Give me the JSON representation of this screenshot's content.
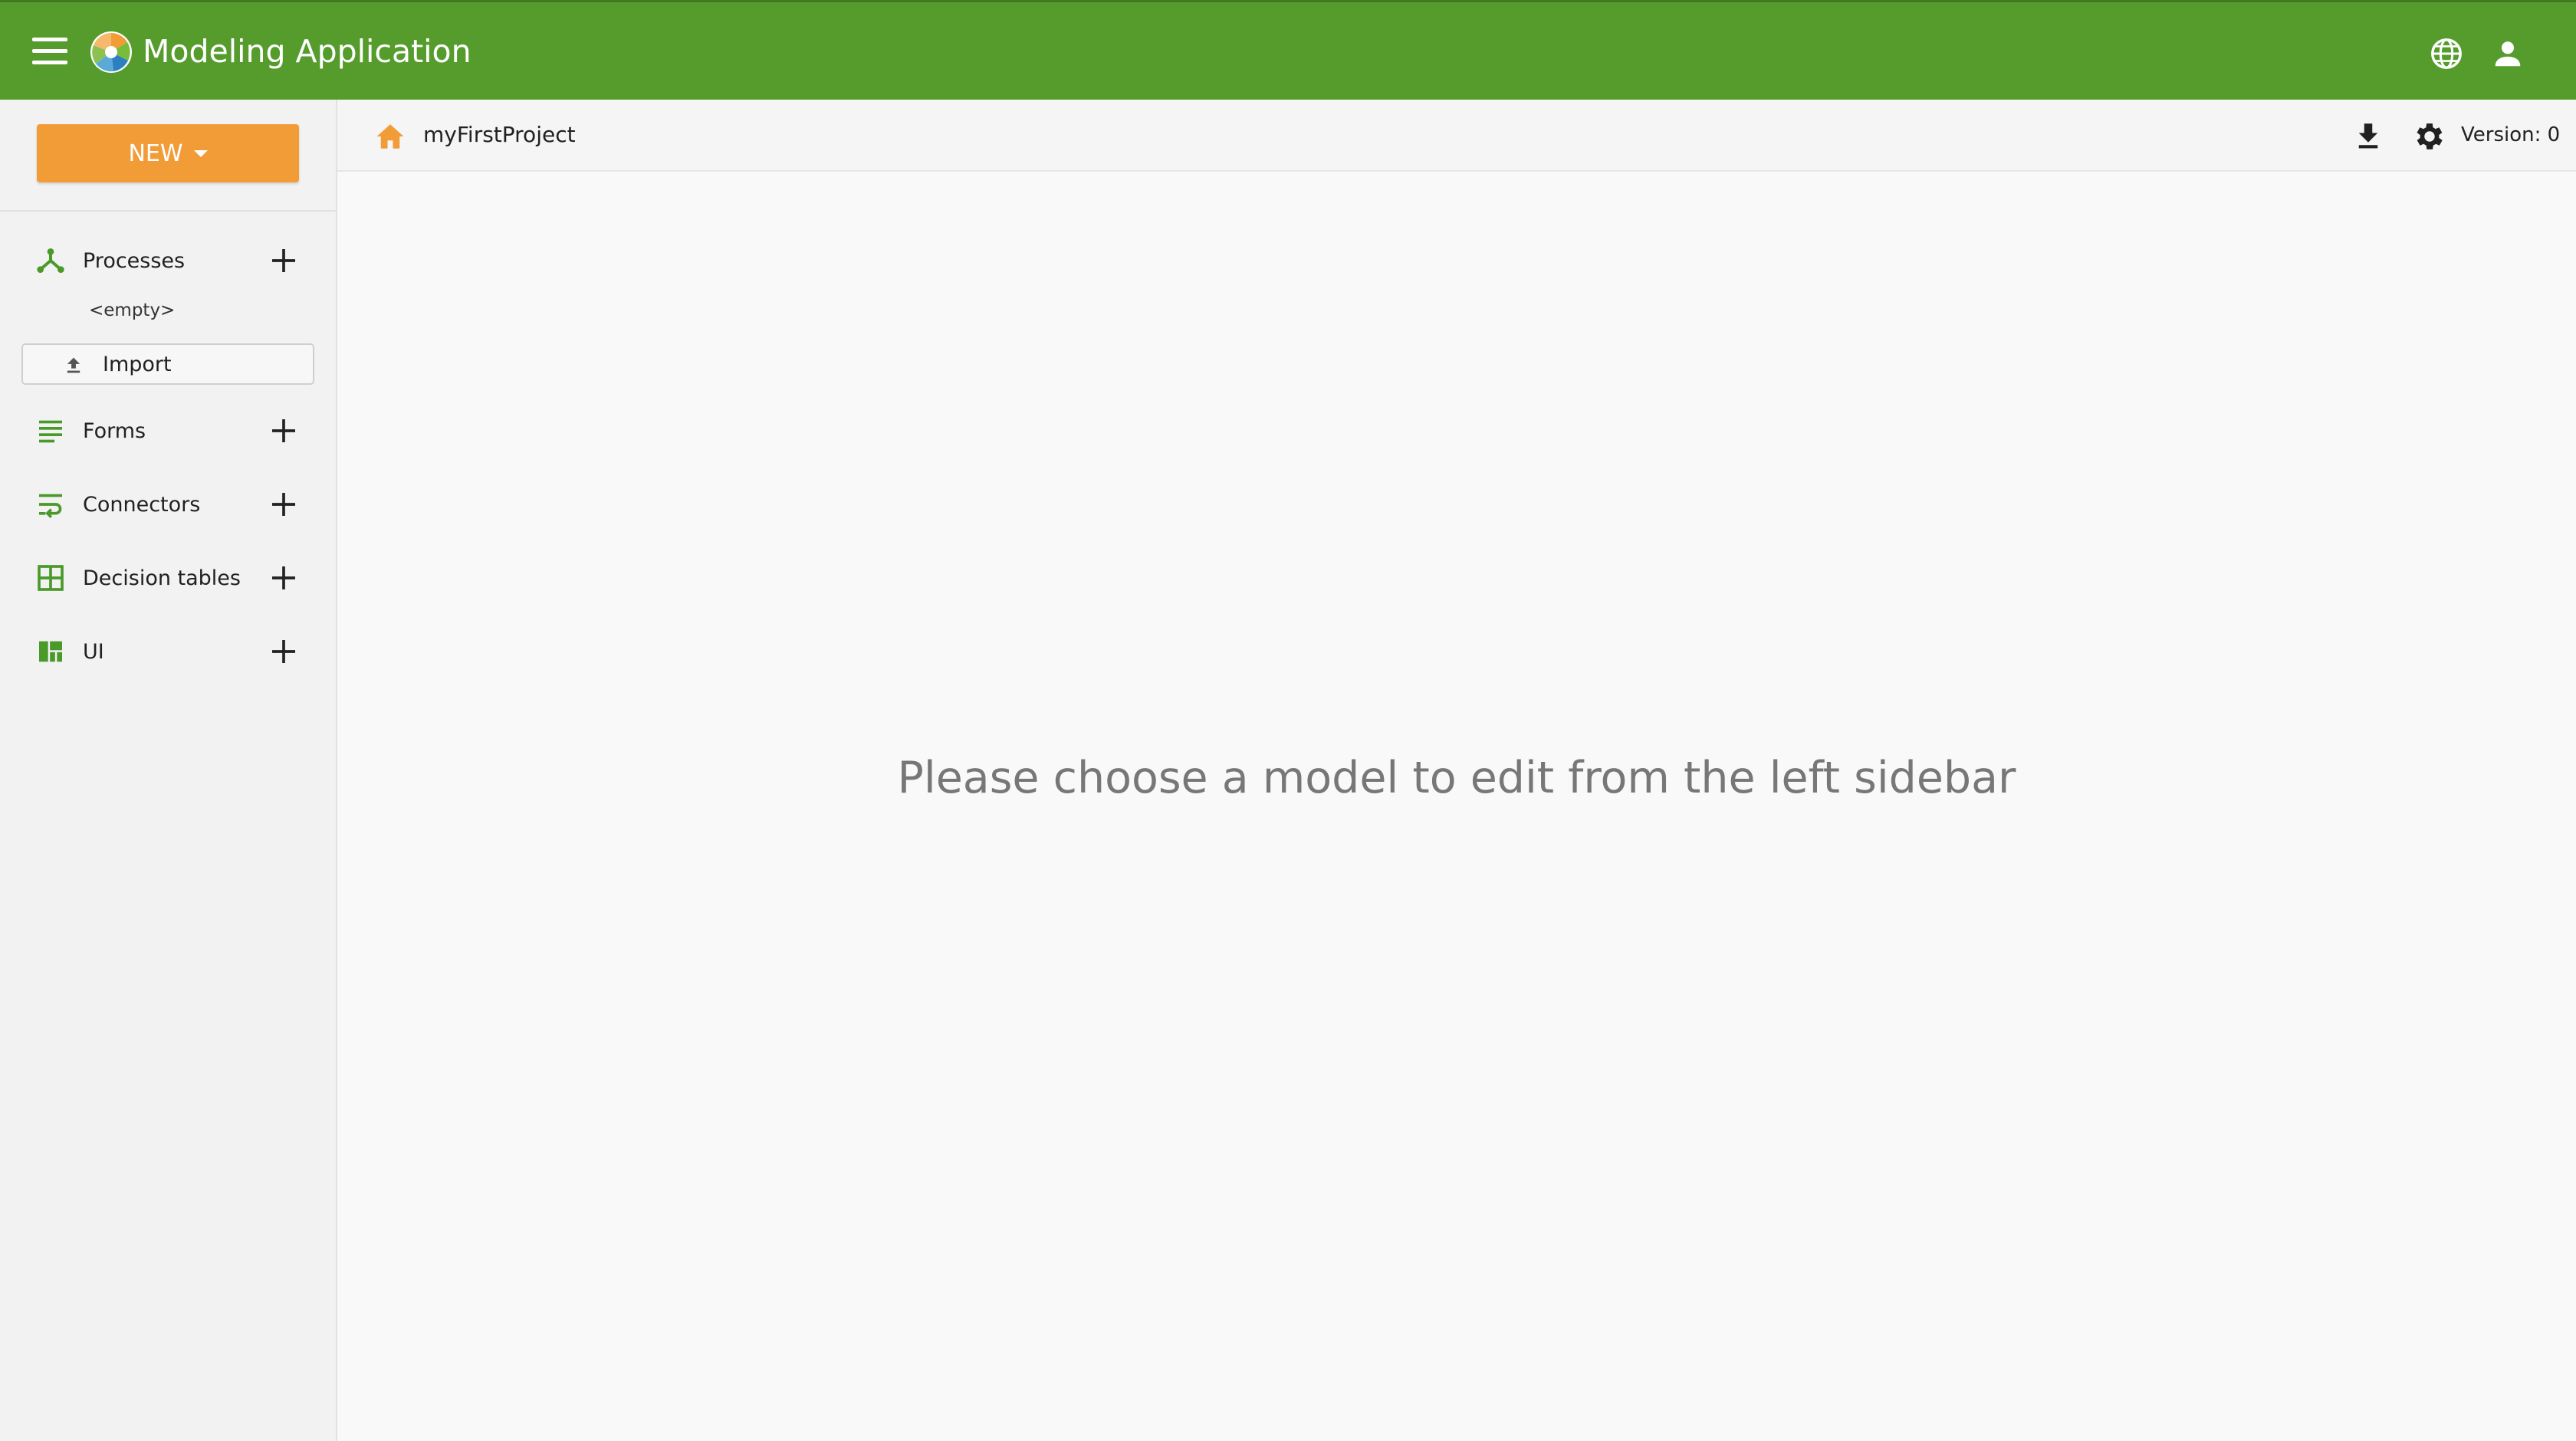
{
  "app": {
    "title": "Modeling Application"
  },
  "colors": {
    "header_green": "#559c2d",
    "accent_orange": "#f29c38",
    "icon_green": "#4a9a2a"
  },
  "sidebar": {
    "new_button_label": "NEW",
    "items": [
      {
        "label": "Processes",
        "icon": "processes-icon"
      },
      {
        "label": "Forms",
        "icon": "forms-icon"
      },
      {
        "label": "Connectors",
        "icon": "connectors-icon"
      },
      {
        "label": "Decision tables",
        "icon": "decision-tables-icon"
      },
      {
        "label": "UI",
        "icon": "ui-icon"
      }
    ],
    "processes_empty_label": "<empty>",
    "import_label": "Import"
  },
  "main": {
    "project_name": "myFirstProject",
    "version_label": "Version: 0",
    "placeholder_message": "Please choose a model to edit from the left sidebar"
  }
}
